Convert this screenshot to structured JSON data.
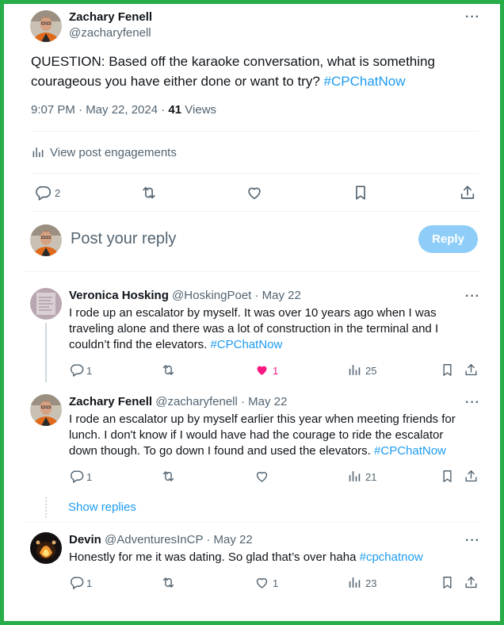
{
  "main_post": {
    "author_name": "Zachary Fenell",
    "author_handle": "@zacharyfenell",
    "text_main": "QUESTION: Based off the karaoke conversation, what is something courageous you have either done or want to try?",
    "hashtag": "#CPChatNow",
    "time": "9:07 PM · May 22, 2024 ·",
    "views_count": "41",
    "views_label": "Views",
    "engagements_label": "View post engagements",
    "reply_count": "2"
  },
  "composer": {
    "placeholder": "Post your reply",
    "reply_button": "Reply"
  },
  "replies": [
    {
      "author_name": "Veronica Hosking",
      "meta": "@HoskingPoet · May 22",
      "text": "I rode up an escalator by myself. It was over 10 years ago when I was traveling alone and there was a lot of construction in the terminal and I couldn’t find the elevators.",
      "hashtag": "#CPChatNow",
      "replies": "1",
      "likes": "1",
      "views": "25"
    },
    {
      "author_name": "Zachary Fenell",
      "meta": "@zacharyfenell · May 22",
      "text": "I rode an escalator up by myself earlier this year when meeting friends for lunch. I don't know if I would have had the courage to ride the escalator down though. To go down I found and used the elevators.",
      "hashtag": "#CPChatNow",
      "replies": "1",
      "likes": "",
      "views": "21",
      "show_replies": "Show replies"
    },
    {
      "author_name": "Devin",
      "meta": "@AdventuresInCP · May 22",
      "text": "Honestly for me it was dating. So glad that’s over haha",
      "hashtag": "#cpchatnow",
      "replies": "1",
      "likes": "1",
      "views": "23"
    }
  ],
  "colors": {
    "frame": "#27ae48",
    "accent": "#1d9bf0",
    "like": "#f91880",
    "reply_button_disabled": "#8ecdf8"
  },
  "icons": [
    "reply-icon",
    "retweet-icon",
    "like-icon",
    "bookmark-icon",
    "share-icon",
    "views-icon",
    "more-icon"
  ]
}
